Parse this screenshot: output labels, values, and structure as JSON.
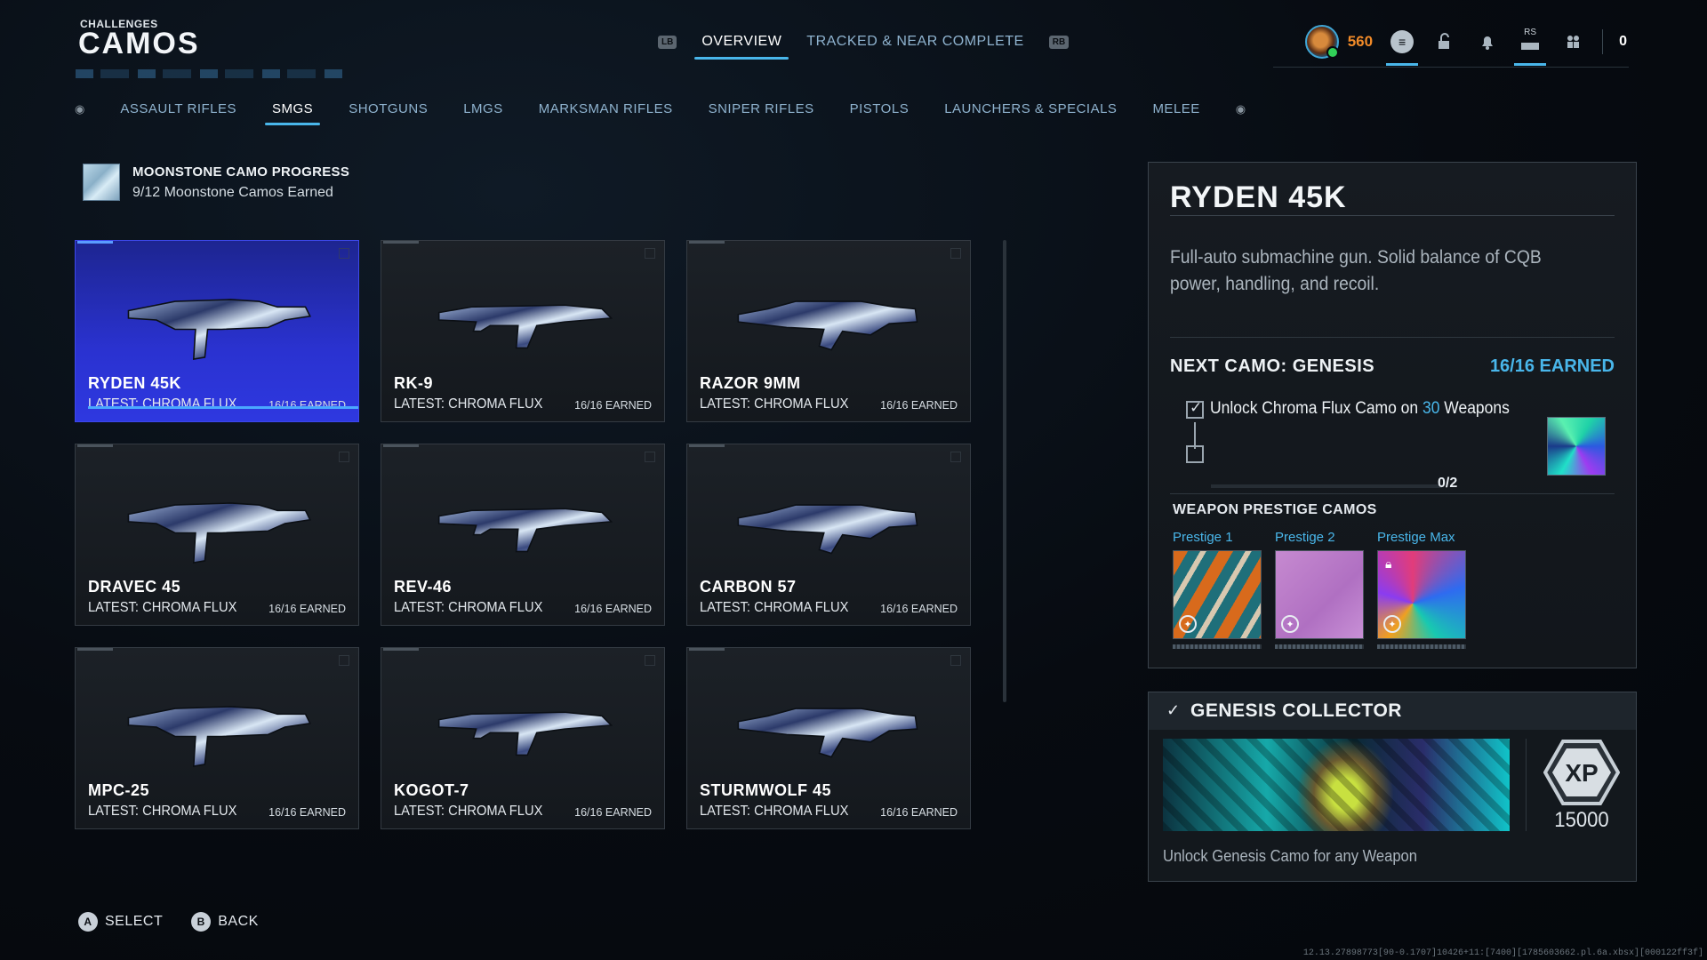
{
  "header": {
    "subtitle": "CHALLENGES",
    "title": "CAMOS"
  },
  "top_nav": {
    "left_bumper": "LB",
    "right_bumper": "RB",
    "tabs": [
      {
        "label": "OVERVIEW",
        "active": true
      },
      {
        "label": "TRACKED & NEAR COMPLETE",
        "active": false
      }
    ]
  },
  "top_right": {
    "currency": "560",
    "rs_label": "RS",
    "count": "0"
  },
  "categories": {
    "tabs": [
      "ASSAULT RIFLES",
      "SMGS",
      "SHOTGUNS",
      "LMGS",
      "MARKSMAN RIFLES",
      "SNIPER RIFLES",
      "PISTOLS",
      "LAUNCHERS & SPECIALS",
      "MELEE"
    ],
    "active": "SMGS"
  },
  "progress": {
    "title": "MOONSTONE CAMO PROGRESS",
    "subtitle": "9/12 Moonstone Camos Earned"
  },
  "weapons": [
    {
      "name": "RYDEN 45K",
      "latest": "LATEST: CHROMA FLUX",
      "earned": "16/16 EARNED",
      "selected": true
    },
    {
      "name": "RK-9",
      "latest": "LATEST: CHROMA FLUX",
      "earned": "16/16 EARNED"
    },
    {
      "name": "RAZOR 9MM",
      "latest": "LATEST: CHROMA FLUX",
      "earned": "16/16 EARNED"
    },
    {
      "name": "DRAVEC 45",
      "latest": "LATEST: CHROMA FLUX",
      "earned": "16/16 EARNED"
    },
    {
      "name": "REV-46",
      "latest": "LATEST: CHROMA FLUX",
      "earned": "16/16 EARNED"
    },
    {
      "name": "CARBON 57",
      "latest": "LATEST: CHROMA FLUX",
      "earned": "16/16 EARNED"
    },
    {
      "name": "MPC-25",
      "latest": "LATEST: CHROMA FLUX",
      "earned": "16/16 EARNED"
    },
    {
      "name": "KOGOT-7",
      "latest": "LATEST: CHROMA FLUX",
      "earned": "16/16 EARNED"
    },
    {
      "name": "STURMWOLF 45",
      "latest": "LATEST: CHROMA FLUX",
      "earned": "16/16 EARNED"
    }
  ],
  "detail": {
    "title": "RYDEN 45K",
    "description": "Full-auto submachine gun. Solid balance of CQB power, handling, and recoil.",
    "next_camo_label": "NEXT CAMO: GENESIS",
    "next_camo_earned": "16/16 EARNED",
    "requirement_pre": "Unlock Chroma Flux Camo on ",
    "requirement_num": "30",
    "requirement_post": " Weapons",
    "requirement_progress": "0/2",
    "prestige_title": "WEAPON PRESTIGE CAMOS",
    "prestige": [
      {
        "label": "Prestige 1",
        "locked": false
      },
      {
        "label": "Prestige 2",
        "locked": false
      },
      {
        "label": "Prestige Max",
        "locked": true
      }
    ]
  },
  "reward": {
    "title": "GENESIS COLLECTOR",
    "xp_label": "XP",
    "xp_value": "15000",
    "description": "Unlock Genesis Camo for any Weapon"
  },
  "footer": [
    {
      "key": "A",
      "label": "SELECT"
    },
    {
      "key": "B",
      "label": "BACK"
    }
  ],
  "build_id": "12.13.27898773[90-0.1707]10426+11:[7400][1785603662.pl.6a.xbsx][000122ff3f]",
  "colors": {
    "accent": "#49b6ea",
    "selected_card": "#2a32d0",
    "currency": "#f08a28"
  }
}
